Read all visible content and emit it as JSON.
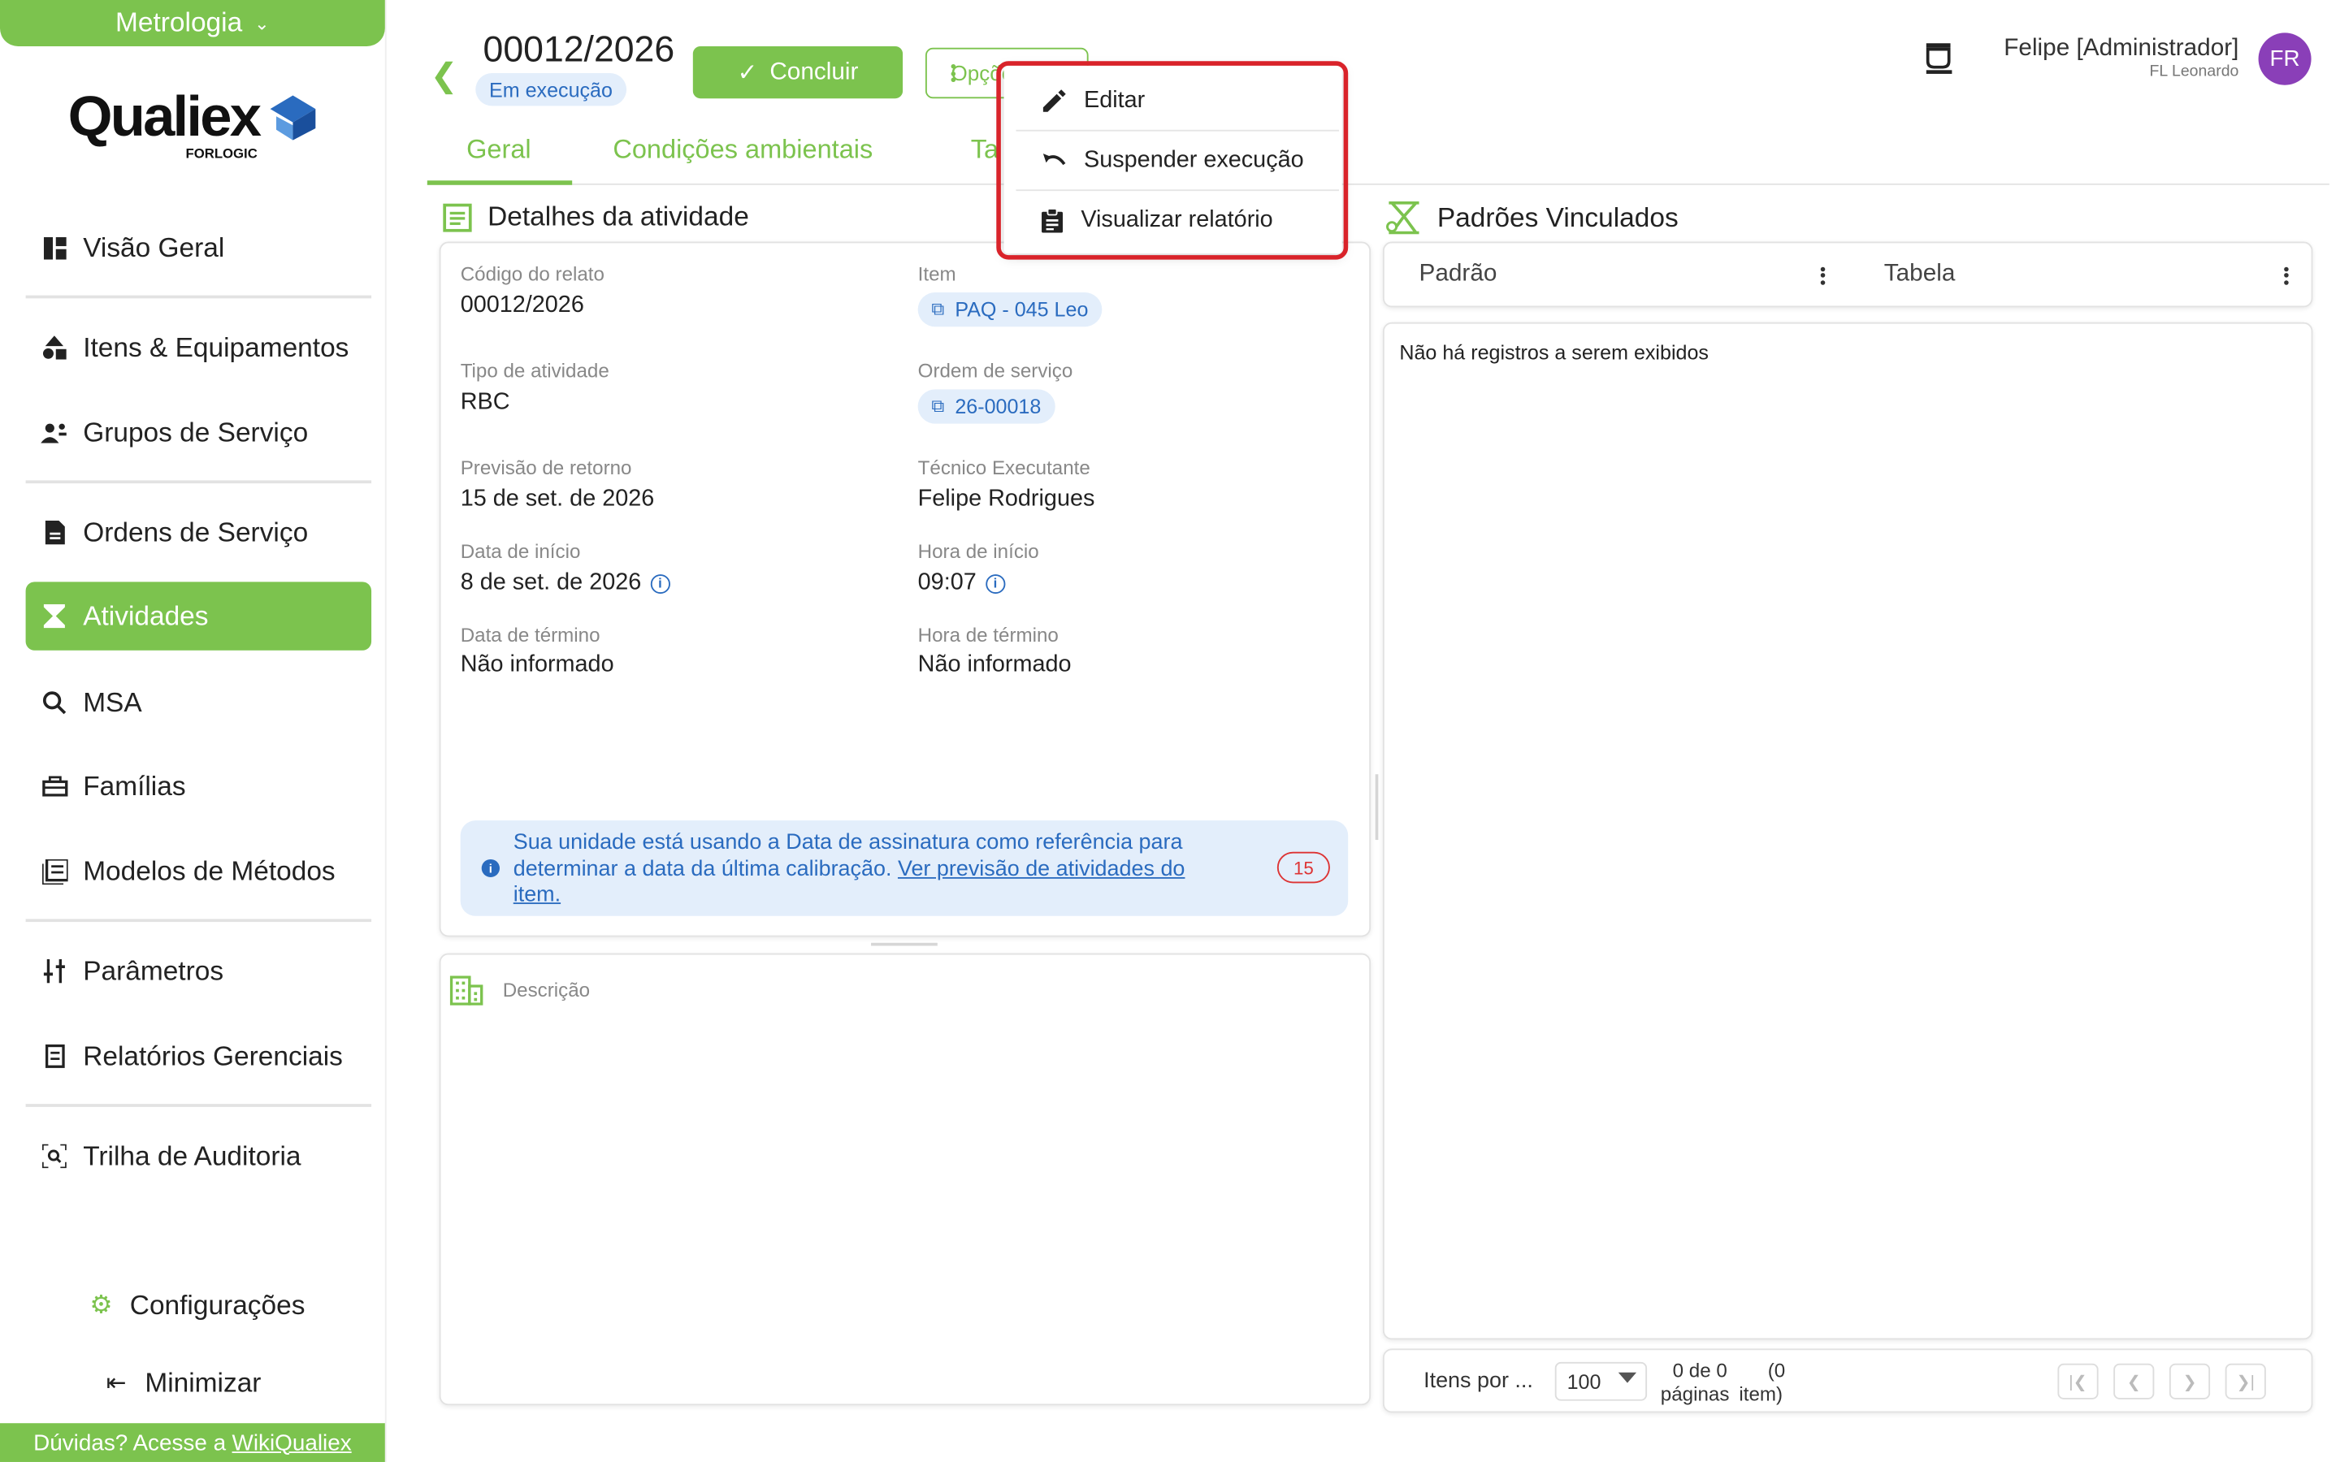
{
  "sidebar": {
    "module": "Metrologia",
    "logo": "Qualiex",
    "logo_sub": "FORLOGIC",
    "items": [
      {
        "label": "Visão Geral"
      },
      {
        "label": "Itens & Equipamentos"
      },
      {
        "label": "Grupos de Serviço"
      },
      {
        "label": "Ordens de Serviço"
      },
      {
        "label": "Atividades"
      },
      {
        "label": "MSA"
      },
      {
        "label": "Famílias"
      },
      {
        "label": "Modelos de Métodos"
      },
      {
        "label": "Parâmetros"
      },
      {
        "label": "Relatórios Gerenciais"
      },
      {
        "label": "Trilha de Auditoria"
      }
    ],
    "settings": "Configurações",
    "minimize": "Minimizar",
    "help_prefix": "Dúvidas? Acesse a",
    "help_link": "WikiQualiex"
  },
  "header": {
    "title": "00012/2026",
    "status": "Em execução",
    "conclude": "Concluir",
    "options": "Opções",
    "user_name": "Felipe [Administrador]",
    "user_unit": "FL Leonardo",
    "avatar": "FR"
  },
  "tabs": [
    {
      "label": "Geral"
    },
    {
      "label": "Condições ambientais"
    },
    {
      "label": "Ta"
    }
  ],
  "menu": {
    "items": [
      {
        "label": "Editar"
      },
      {
        "label": "Suspender execução"
      },
      {
        "label": "Visualizar relatório"
      }
    ]
  },
  "details": {
    "title": "Detalhes da atividade",
    "code_label": "Código do relato",
    "code_value": "00012/2026",
    "item_label": "Item",
    "item_value": "PAQ - 045 Leo",
    "type_label": "Tipo de atividade",
    "type_value": "RBC",
    "os_label": "Ordem de serviço",
    "os_value": "26-00018",
    "return_label": "Previsão de retorno",
    "return_value": "15 de set. de 2026",
    "tech_label": "Técnico Executante",
    "tech_value": "Felipe Rodrigues",
    "start_date_label": "Data de início",
    "start_date_value": "8 de set. de 2026",
    "start_time_label": "Hora de início",
    "start_time_value": "09:07",
    "end_date_label": "Data de término",
    "end_date_value": "Não informado",
    "end_time_label": "Hora de término",
    "end_time_value": "Não informado",
    "alert_text": "Sua unidade está usando a Data de assinatura como referência para determinar a data da última calibração.",
    "alert_link": "Ver previsão de atividades do item.",
    "alert_count": "15"
  },
  "description": {
    "label": "Descrição"
  },
  "standards": {
    "title": "Padrões Vinculados",
    "col1": "Padrão",
    "col2": "Tabela",
    "empty": "Não há registros a serem exibidos",
    "per_page_label": "Itens por ...",
    "per_page_value": "100",
    "count": "0 de 0",
    "count_sub": "páginas",
    "count_paren": "(0",
    "count_paren_sub": "item)"
  },
  "colors": {
    "brand": "#7cc34e",
    "info": "#2a6bbf",
    "highlight": "#d9232a",
    "avatar": "#8a3fb8"
  }
}
